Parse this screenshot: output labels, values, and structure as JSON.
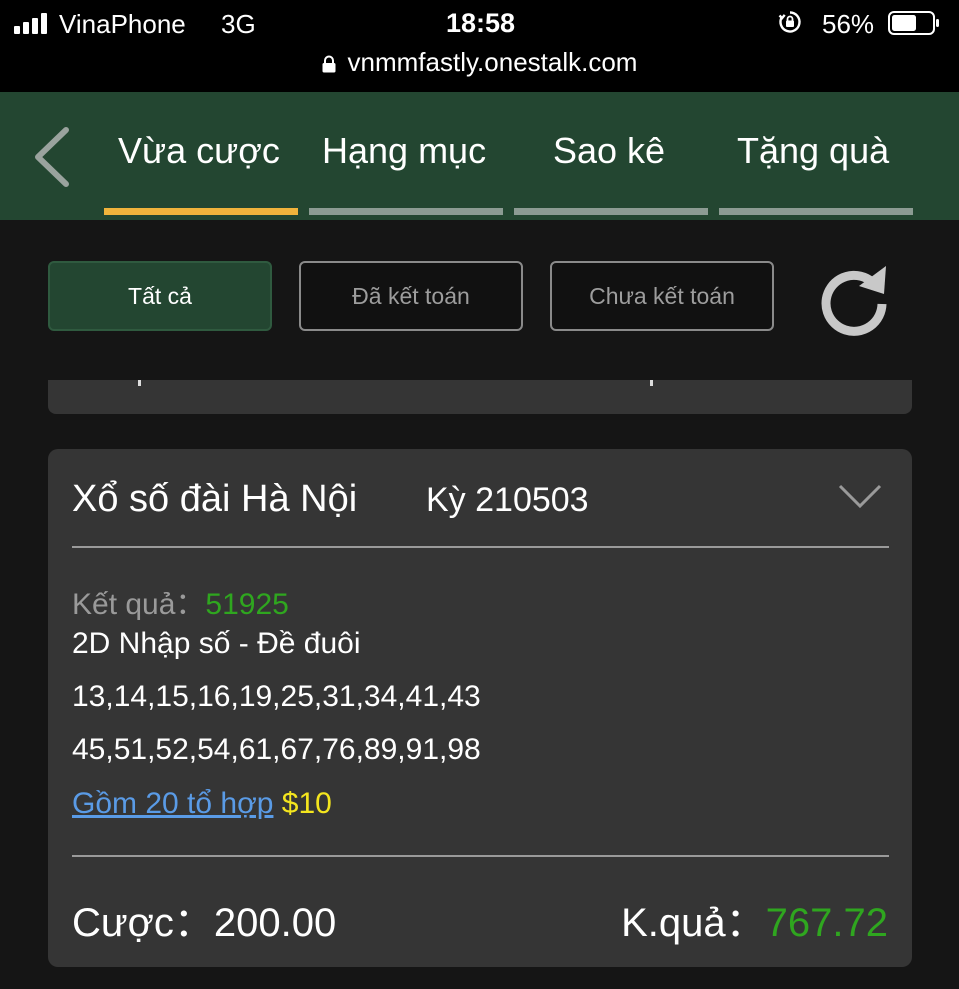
{
  "status_bar": {
    "carrier": "VinaPhone",
    "network": "3G",
    "time": "18:58",
    "battery": "56%",
    "url": "vnmmfastly.onestalk.com"
  },
  "tabs": [
    {
      "label": "Vừa cược",
      "active": true
    },
    {
      "label": "Hạng mục",
      "active": false
    },
    {
      "label": "Sao kê",
      "active": false
    },
    {
      "label": "Tặng quà",
      "active": false
    }
  ],
  "filters": [
    {
      "label": "Tất cả",
      "active": true
    },
    {
      "label": "Đã kết toán",
      "active": false
    },
    {
      "label": "Chưa kết toán",
      "active": false
    }
  ],
  "card": {
    "title": "Xổ số đài Hà Nội",
    "period": "Kỳ 210503",
    "result_label": "Kết quả：",
    "result_value": "51925",
    "bet_type": "2D Nhập số - Đề đuôi",
    "numbers_line1": "13,14,15,16,19,25,31,34,41,43",
    "numbers_line2": "45,51,52,54,61,67,76,89,91,98",
    "combo_link": "Gồm 20 tổ hợp",
    "combo_amount": "$10",
    "bet_label": "Cược：",
    "bet_value": "200.00",
    "payout_label": "K.quả：",
    "payout_value": "767.72"
  },
  "colors": {
    "header_green": "#234631",
    "tab_active": "#f0b33c",
    "result_green": "#2fa61f",
    "link_blue": "#5a9be6",
    "amount_yellow": "#f4e51e"
  }
}
